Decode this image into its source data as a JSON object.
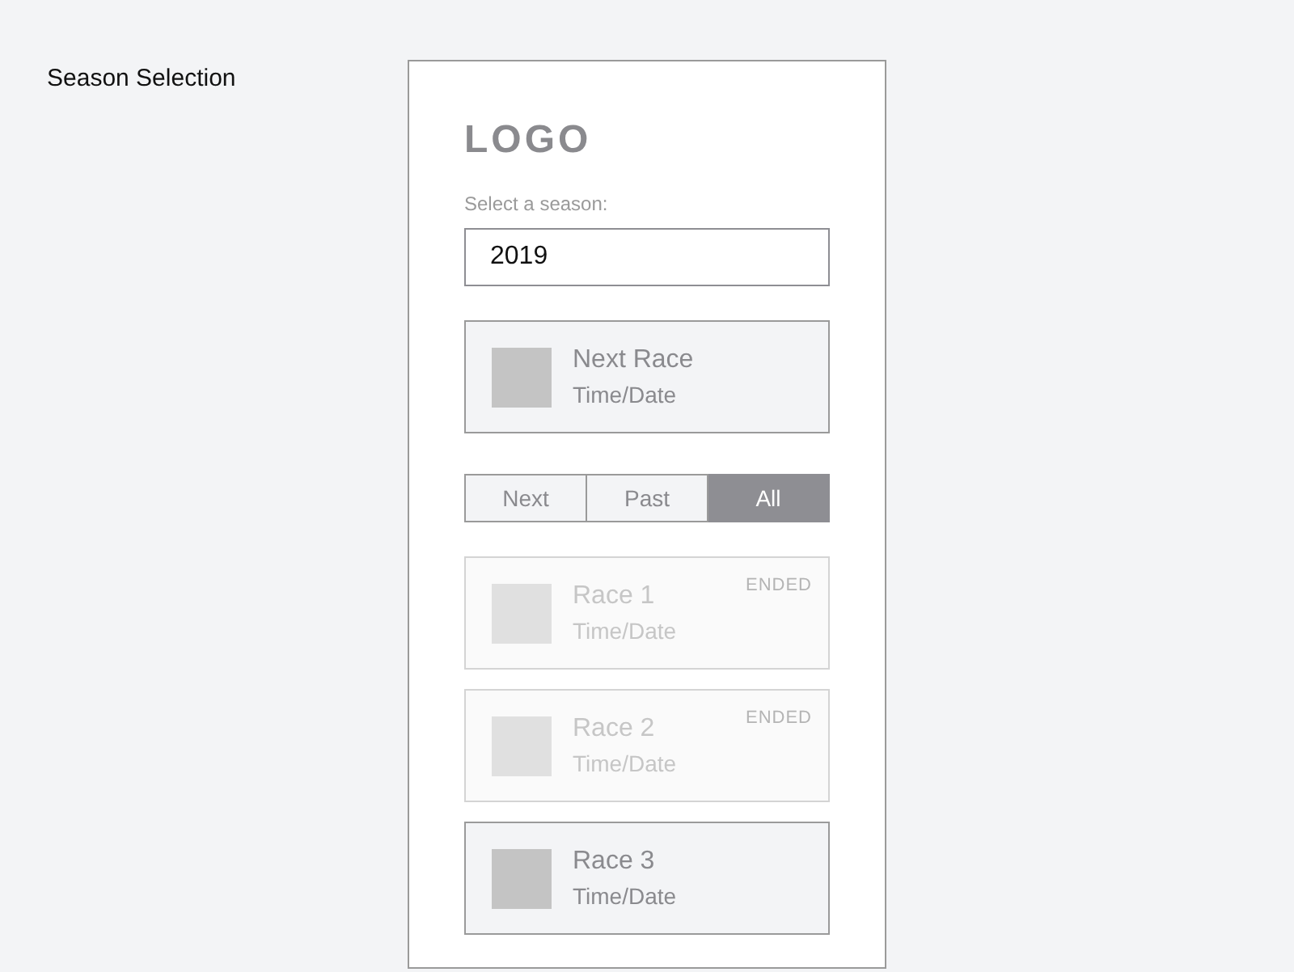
{
  "page_title": "Season Selection",
  "logo": "LOGO",
  "season_label": "Select a season:",
  "season_field": {
    "value": "2019"
  },
  "next_race": {
    "title": "Next Race",
    "subtitle": "Time/Date"
  },
  "tabs": [
    {
      "label": "Next",
      "selected": false
    },
    {
      "label": "Past",
      "selected": false
    },
    {
      "label": "All",
      "selected": true
    }
  ],
  "races": [
    {
      "title": "Race 1",
      "subtitle": "Time/Date",
      "ended": true,
      "badge": "ENDED"
    },
    {
      "title": "Race 2",
      "subtitle": "Time/Date",
      "ended": true,
      "badge": "ENDED"
    },
    {
      "title": "Race 3",
      "subtitle": "Time/Date",
      "ended": false
    }
  ]
}
